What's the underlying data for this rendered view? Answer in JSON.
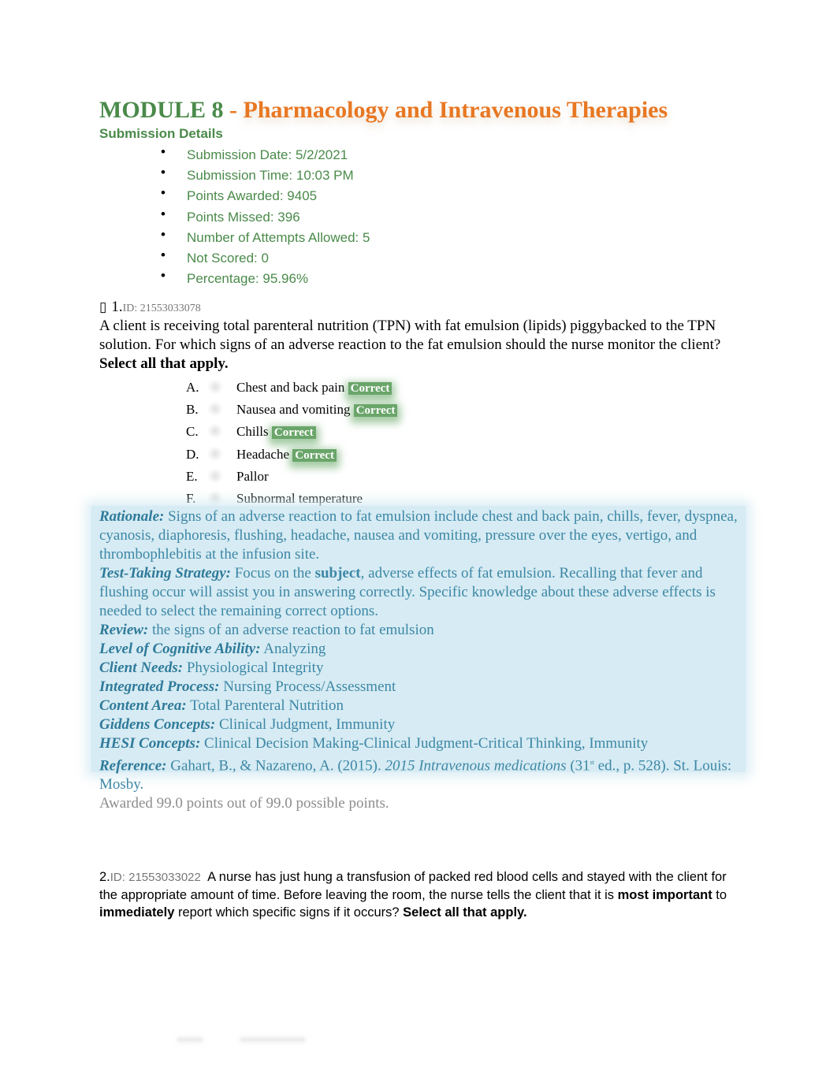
{
  "header": {
    "module": "MODULE 8",
    "separator": " - ",
    "subject": "Pharmacology and Intravenous Therapies",
    "submission_heading": "Submission Details"
  },
  "submission_details": [
    {
      "label": "Submission Date:",
      "value": "5/2/2021"
    },
    {
      "label": "Submission Time:",
      "value": "10:03 PM"
    },
    {
      "label": "Points Awarded:",
      "value": "9405"
    },
    {
      "label": "Points Missed:",
      "value": "396"
    },
    {
      "label": "Number of Attempts Allowed:",
      "value": "5"
    },
    {
      "label": "Not Scored:",
      "value": "0"
    },
    {
      "label": "Percentage:",
      "value": "95.96%"
    }
  ],
  "question1": {
    "box_icon": "▯",
    "number": "1.",
    "id": "ID: 21553033078",
    "stem": "A client is receiving total parenteral nutrition (TPN) with fat emulsion (lipids) piggybacked to the TPN solution. For which signs of an adverse reaction to the fat emulsion should the nurse monitor the client?",
    "instruction": "Select all that apply.",
    "options": [
      {
        "letter": "A.",
        "text": "Chest and back pain",
        "badge": "Correct"
      },
      {
        "letter": "B.",
        "text": "Nausea and vomiting",
        "badge": "Correct"
      },
      {
        "letter": "C.",
        "text": "Chills",
        "badge": "Correct"
      },
      {
        "letter": "D.",
        "text": "Headache",
        "badge": "Correct"
      },
      {
        "letter": "E.",
        "text": "Pallor",
        "badge": ""
      },
      {
        "letter": "F.",
        "text": "Subnormal temperature",
        "badge": ""
      }
    ],
    "rationale": {
      "rationale_label": "Rationale:",
      "rationale_text": " Signs of an adverse reaction to fat emulsion include chest and back pain, chills, fever, dyspnea, cyanosis, diaphoresis, flushing, headache, nausea and vomiting, pressure over the eyes, vertigo, and thrombophlebitis at the infusion site.",
      "strategy_label": "Test-Taking Strategy:",
      "strategy_pre": " Focus on the ",
      "strategy_bold": "subject",
      "strategy_post": ", adverse effects of fat emulsion. Recalling that fever and flushing occur will assist you in answering correctly. Specific knowledge about these adverse effects is needed to select the remaining correct options.",
      "review_label": "Review:",
      "review_text": " the signs of an adverse reaction to fat emulsion",
      "cognitive_label": "Level of Cognitive Ability:",
      "cognitive_text": " Analyzing",
      "client_needs_label": "Client Needs:",
      "client_needs_text": " Physiological Integrity",
      "process_label": "Integrated Process:",
      "process_text": " Nursing Process/Assessment",
      "content_label": "Content Area:",
      "content_text": " Total Parenteral Nutrition",
      "giddens_label": "Giddens Concepts:",
      "giddens_text": " Clinical Judgment, Immunity",
      "hesi_label": "HESI Concepts:",
      "hesi_text": " Clinical Decision Making-Clinical Judgment-Critical Thinking, Immunity",
      "reference_label": "Reference:",
      "reference_pre": " Gahart, B., & Nazareno, A. (2015). ",
      "reference_title": "2015 Intravenous medications",
      "reference_ed": " (31",
      "reference_sup": "st",
      "reference_post": " ed., p. 528). St. Louis: Mosby."
    },
    "awarded": "Awarded 99.0 points out of 99.0 possible points."
  },
  "question2": {
    "number": "2.",
    "id": "ID: 21553033022",
    "stem_pre": "  A nurse has just hung a transfusion of packed red blood cells and stayed with the client for the appropriate amount of time. Before leaving the room, the nurse tells the client that it is ",
    "bold1": "most important",
    "mid1": " to ",
    "bold2": "immediately",
    "mid2": " report which specific signs if it occurs? ",
    "instruction": "Select all that apply."
  }
}
